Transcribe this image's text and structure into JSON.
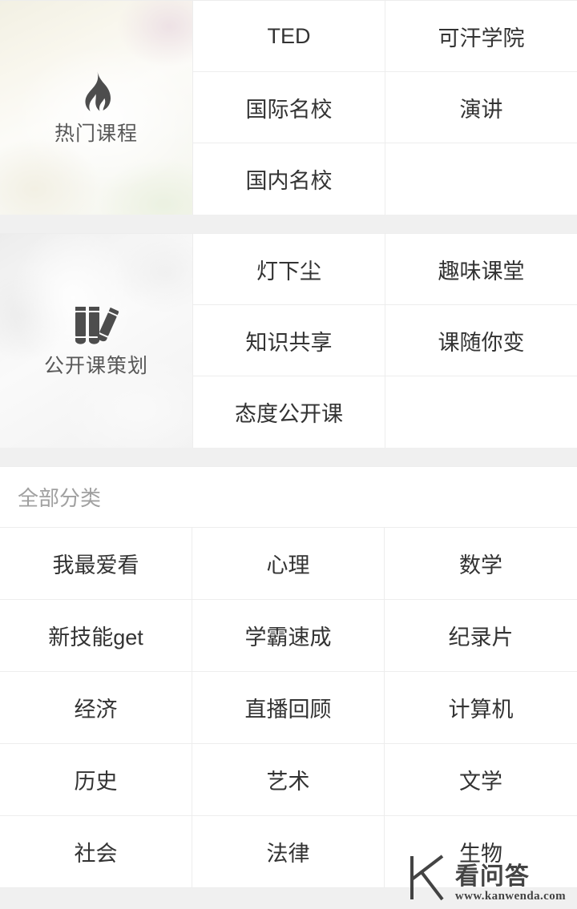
{
  "sections": [
    {
      "id": "hot-courses",
      "banner": {
        "label": "热门课程",
        "icon": "flame-icon",
        "photo_style": "warm"
      },
      "items": [
        "TED",
        "可汗学院",
        "国际名校",
        "演讲",
        "国内名校",
        ""
      ]
    },
    {
      "id": "open-course-planning",
      "banner": {
        "label": "公开课策划",
        "icon": "pencils-icon",
        "photo_style": "gray"
      },
      "items": [
        "灯下尘",
        "趣味课堂",
        "知识共享",
        "课随你变",
        "态度公开课",
        ""
      ]
    }
  ],
  "all_categories": {
    "title": "全部分类",
    "items": [
      "我最爱看",
      "心理",
      "数学",
      "新技能get",
      "学霸速成",
      "纪录片",
      "经济",
      "直播回顾",
      "计算机",
      "历史",
      "艺术",
      "文学",
      "社会",
      "法律",
      "生物"
    ]
  },
  "watermark": {
    "name": "看问答",
    "url": "www.kanwenda.com",
    "logo": "k-logo-icon"
  },
  "colors": {
    "text": "#333333",
    "muted": "#a0a0a0",
    "divider": "#ededed",
    "gap": "#f0f0f0",
    "icon": "#4d4d4d"
  }
}
